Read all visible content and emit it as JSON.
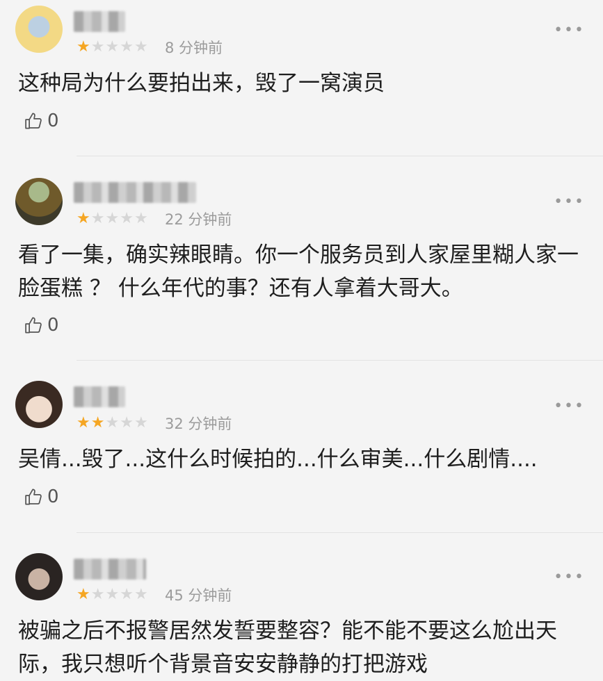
{
  "reviews": [
    {
      "stars": 1,
      "time": "8 分钟前",
      "content": "这种局为什么要拍出来，毁了一窝演员",
      "likes": "0",
      "more_label": "•••",
      "avatar_colors": [
        "#f3d985",
        "#bcd0e2"
      ]
    },
    {
      "stars": 1,
      "time": "22 分钟前",
      "content": "看了一集，确实辣眼睛。你一个服务员到人家屋里糊人家一脸蛋糕 ？ 什么年代的事？还有人拿着大哥大。",
      "likes": "0",
      "more_label": "•••",
      "avatar_colors": [
        "#6f5a2b",
        "#3d3a2a"
      ]
    },
    {
      "stars": 2,
      "time": "32 分钟前",
      "content": "吴倩...毁了...这什么时候拍的...什么审美...什么剧情....",
      "likes": "0",
      "more_label": "•••",
      "avatar_colors": [
        "#e8d2c2",
        "#3a2a22"
      ]
    },
    {
      "stars": 1,
      "time": "45 分钟前",
      "content": "被骗之后不报警居然发誓要整容？能不能不要这么尬出天际，我只想听个背景音安安静静的打把游戏",
      "likes": "0",
      "more_label": "•••",
      "avatar_colors": [
        "#2a2422",
        "#c9b3a4"
      ]
    }
  ],
  "star_char": "★",
  "colors": {
    "star_on": "#f5a623",
    "star_off": "#d6d6d6",
    "background": "#f4f4f4"
  }
}
